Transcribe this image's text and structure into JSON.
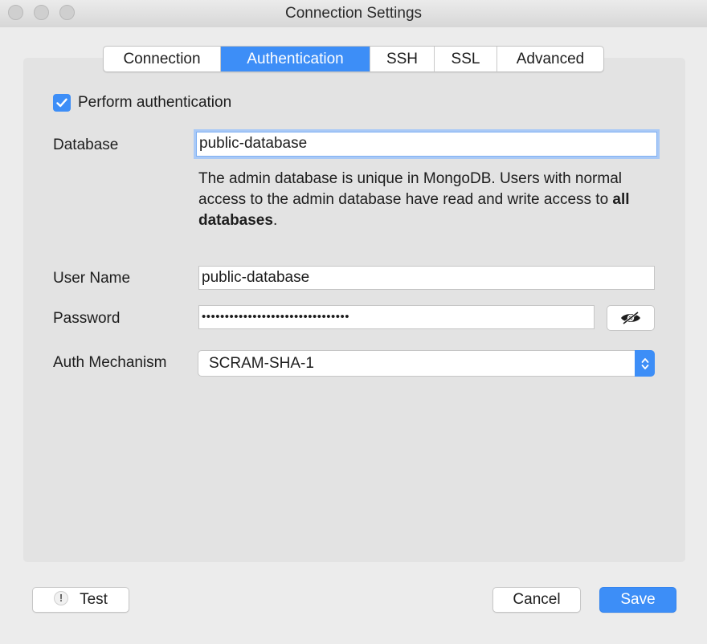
{
  "window": {
    "title": "Connection Settings"
  },
  "tabs": [
    {
      "label": "Connection",
      "active": false
    },
    {
      "label": "Authentication",
      "active": true
    },
    {
      "label": "SSH",
      "active": false
    },
    {
      "label": "SSL",
      "active": false
    },
    {
      "label": "Advanced",
      "active": false
    }
  ],
  "auth": {
    "perform_label": "Perform authentication",
    "perform_checked": true,
    "database_label": "Database",
    "database_value": "public-database",
    "help_prefix": "The admin database is unique in MongoDB. Users with normal access to the admin database have read and write access to ",
    "help_bold": "all databases",
    "help_suffix": ".",
    "username_label": "User Name",
    "username_value": "public-database",
    "password_label": "Password",
    "password_value": "••••••••••••••••••••••••••••••••",
    "password_toggle_icon": "eye-slash-icon",
    "mechanism_label": "Auth Mechanism",
    "mechanism_value": "SCRAM-SHA-1"
  },
  "footer": {
    "test_label": "Test",
    "test_icon": "!",
    "cancel_label": "Cancel",
    "save_label": "Save"
  },
  "colors": {
    "accent": "#3d8ef7",
    "window_bg": "#ececec",
    "panel_bg": "#e3e3e3"
  }
}
